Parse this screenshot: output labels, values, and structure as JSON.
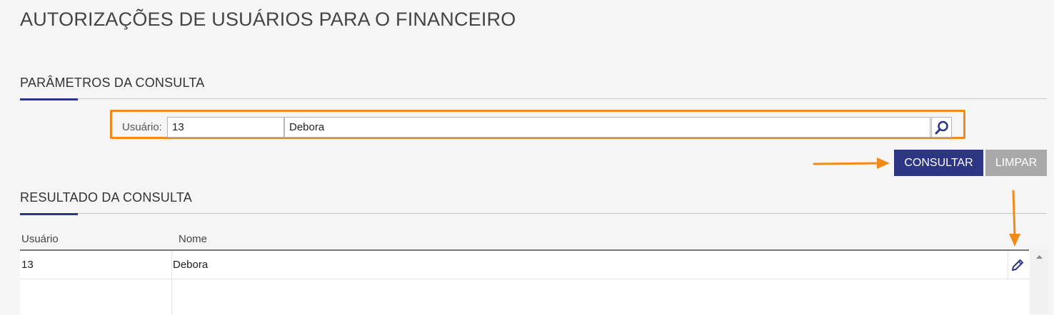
{
  "page": {
    "title": "AUTORIZAÇÕES DE USUÁRIOS PARA O FINANCEIRO"
  },
  "params": {
    "section_title": "PARÂMETROS DA CONSULTA",
    "user_label": "Usuário:",
    "user_code": "13",
    "user_name": "Debora",
    "search_icon": "magnifier-icon"
  },
  "actions": {
    "consultar_label": "CONSULTAR",
    "limpar_label": "LIMPAR"
  },
  "results": {
    "section_title": "RESULTADO DA CONSULTA",
    "columns": [
      "Usuário",
      "Nome"
    ],
    "rows": [
      {
        "usuario": "13",
        "nome": "Debora",
        "action_icon": "pencil-edit-icon"
      }
    ]
  },
  "colors": {
    "accent": "#2d3585",
    "highlight": "#f28a1a",
    "secondary_button": "#a9a9a9",
    "background": "#f5f5f5"
  }
}
